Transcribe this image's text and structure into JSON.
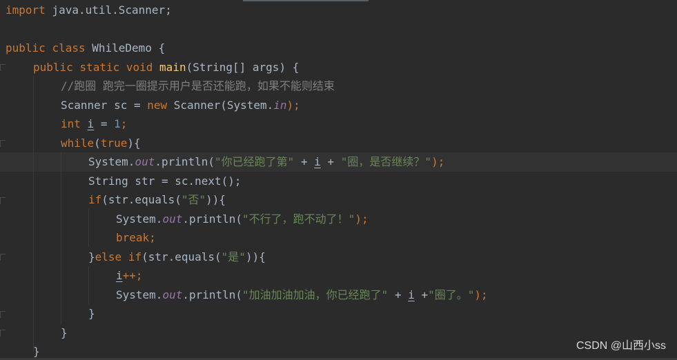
{
  "code": {
    "l1_kw_import": "import",
    "l1_rest": " java.util.Scanner;",
    "l2_kw_public": "public",
    "l2_kw_class": "class",
    "l2_name": "WhileDemo",
    "l2_brace": " {",
    "l3_kw_public": "public",
    "l3_kw_static": "static",
    "l3_kw_void": "void",
    "l3_fn": "main",
    "l3_rest": "(String[] args) {",
    "l4_comment": "//跑圈 跑完一圈提示用户是否还能跑，如果不能则结束",
    "l5_a": "Scanner sc = ",
    "l5_kw_new": "new",
    "l5_b": " Scanner(System.",
    "l5_fld": "in",
    "l5_c": ");",
    "l6_kw_int": "int",
    "l6_var": "i",
    "l6_eq": " = ",
    "l6_num": "1",
    "l6_semi": ";",
    "l7_kw_while": "while",
    "l7_paren_open": "(",
    "l7_kw_true": "true",
    "l7_paren_close": "){",
    "l8_a": "System.",
    "l8_fld": "out",
    "l8_b": ".println(",
    "l8_str1": "\"你已经跑了第\"",
    "l8_plus1": " + ",
    "l8_var": "i",
    "l8_plus2": " + ",
    "l8_str2": "\"圈，是否继续？\"",
    "l8_c": ");",
    "l9_a": "String str = sc.next();",
    "l10_kw_if": "if",
    "l10_a": "(str.equals(",
    "l10_str": "\"否\"",
    "l10_b": ")){",
    "l11_a": "System.",
    "l11_fld": "out",
    "l11_b": ".println(",
    "l11_str": "\"不行了，跑不动了！\"",
    "l11_c": ");",
    "l12_kw_break": "break",
    "l12_semi": ";",
    "l13_a": "}",
    "l13_kw_else": "else",
    "l13_kw_if": "if",
    "l13_b": "(str.equals(",
    "l13_str": "\"是\"",
    "l13_c": ")){",
    "l14_var": "i",
    "l14_a": "++;",
    "l15_a": "System.",
    "l15_fld": "out",
    "l15_b": ".println(",
    "l15_str1": "\"加油加油加油，你已经跑了\"",
    "l15_plus1": " + ",
    "l15_var": "i",
    "l15_plus2": " +",
    "l15_str2": "\"圈了。\"",
    "l15_c": ");",
    "l16_brace": "}",
    "l17_brace": "}",
    "l18_brace": "}"
  },
  "watermark": "CSDN @山西小ss",
  "colors": {
    "background": "#2b2b2b",
    "keyword": "#cc7832",
    "function": "#ffc66d",
    "string": "#6a8759",
    "number": "#6897bb",
    "comment": "#808080",
    "field": "#9876aa",
    "text": "#a9b7c6"
  }
}
